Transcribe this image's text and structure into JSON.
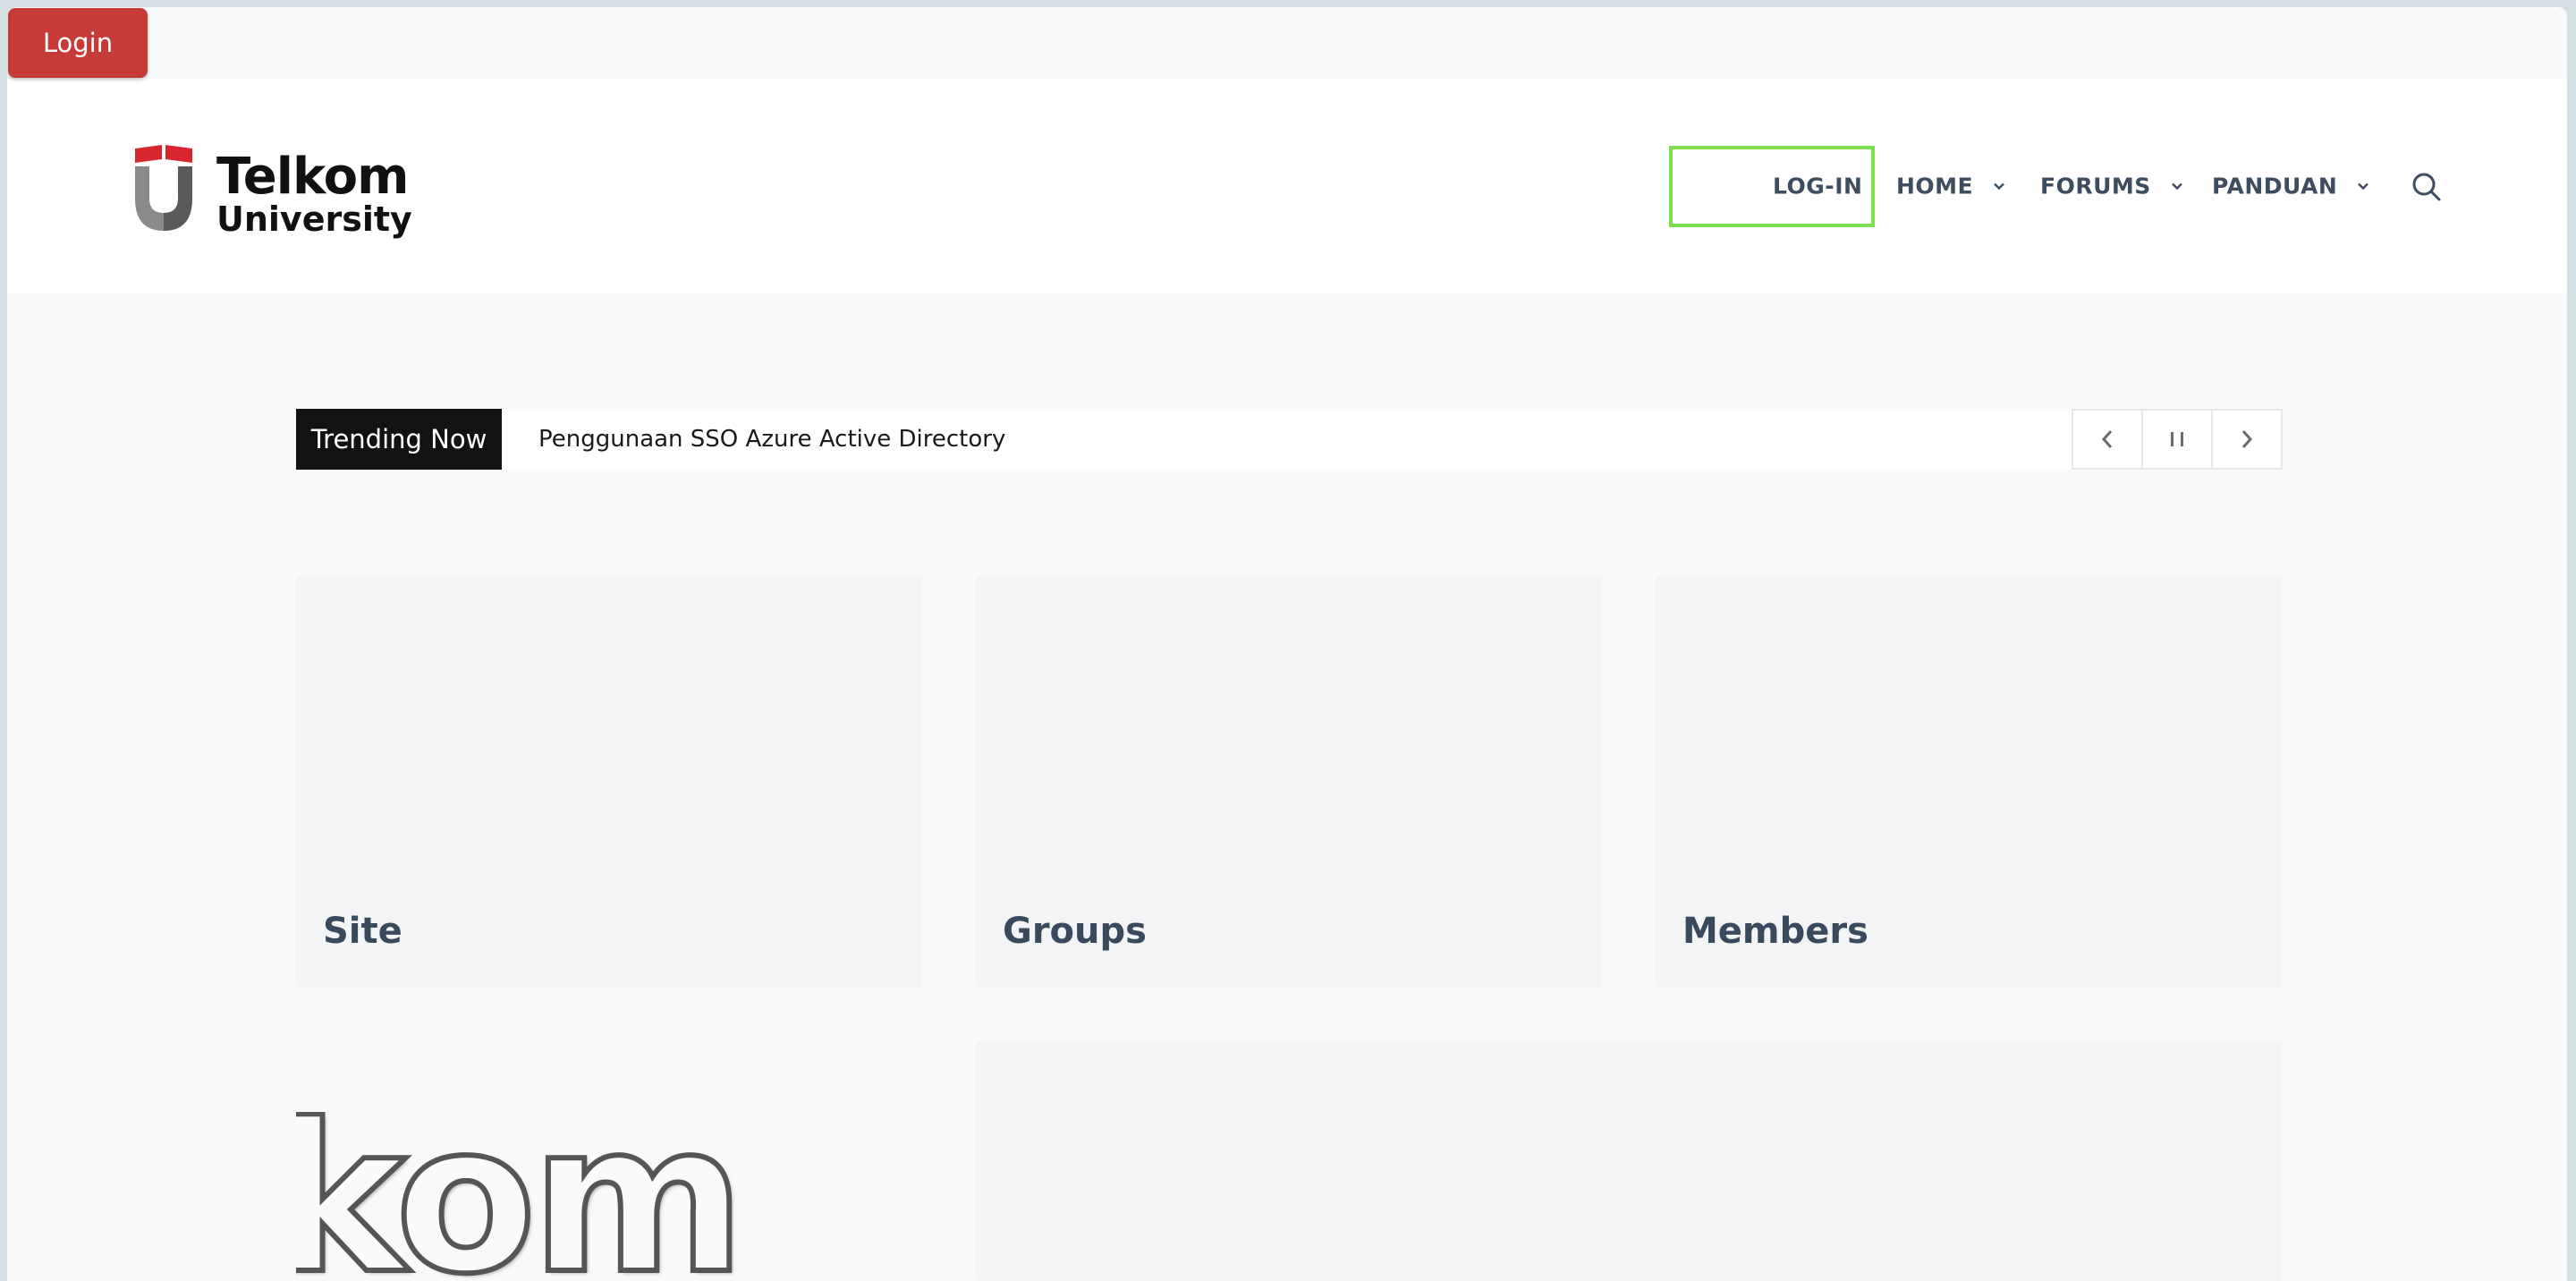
{
  "login_button": {
    "label": "Login"
  },
  "header": {
    "logo": {
      "line1": "Telkom",
      "line2": "University"
    },
    "nav": [
      {
        "label": "LOG-IN",
        "has_dropdown": false
      },
      {
        "label": "HOME",
        "has_dropdown": true
      },
      {
        "label": "FORUMS",
        "has_dropdown": true
      },
      {
        "label": "PANDUAN",
        "has_dropdown": true
      }
    ],
    "search_icon": "search-icon"
  },
  "ticker": {
    "label": "Trending Now",
    "headline": "Penggunaan SSO Azure Active Directory",
    "controls": [
      "chevron-left-icon",
      "pause-icon",
      "chevron-right-icon"
    ]
  },
  "cards": [
    {
      "title": "Site"
    },
    {
      "title": "Groups"
    },
    {
      "title": "Members"
    }
  ],
  "partial_image": {
    "text": "kom"
  },
  "colors": {
    "login_button": "#c63a38",
    "nav_text": "#3d4c5e",
    "highlight": "#7ee050",
    "ticker_label_bg": "#121212",
    "card_bg": "#f3f4f5",
    "logo_red": "#d8262e"
  }
}
